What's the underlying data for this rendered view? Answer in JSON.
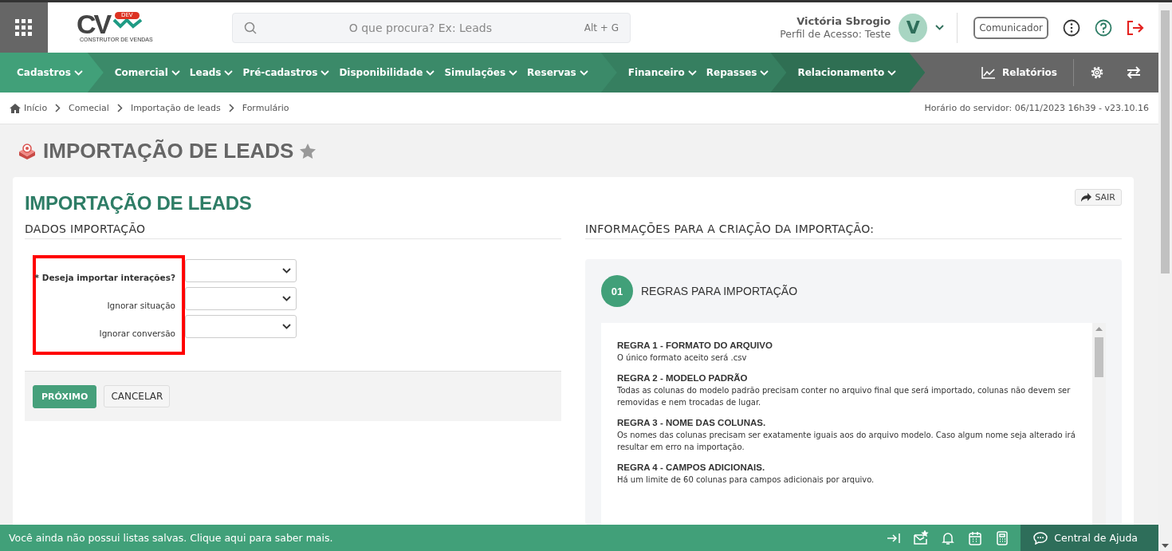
{
  "topbar": {
    "logo": {
      "letters": "CV",
      "badge": "DEV",
      "tagline": "CONSTRUTOR DE VENDAS"
    },
    "search": {
      "placeholder": "O que procura? Ex: Leads",
      "shortcut": "Alt + G"
    },
    "user": {
      "name": "Victória Sbrogio",
      "profile": "Perfil de Acesso: Teste",
      "initial": "V"
    },
    "communicator": "Comunicador"
  },
  "nav": {
    "groups": [
      {
        "color": "#41a079",
        "items": [
          "Cadastros"
        ]
      },
      {
        "color": "#3b8a69",
        "items": [
          "Comercial",
          "Leads",
          "Pré-cadastros",
          "Disponibilidade",
          "Simulações",
          "Reservas"
        ]
      },
      {
        "color": "#367f60",
        "items": [
          "Financeiro",
          "Repasses"
        ]
      },
      {
        "color": "#2f6f53",
        "items": [
          "Relacionamento"
        ]
      }
    ],
    "reports": "Relatórios"
  },
  "breadcrumb": {
    "items": [
      "Início",
      "Comecial",
      "Importação de leads",
      "Formulário"
    ],
    "server_time": "Horário do servidor: 06/11/2023 16h39 - v23.10.16"
  },
  "page_title": "IMPORTAÇÃO DE LEADS",
  "favorite": false,
  "card": {
    "title": "IMPORTAÇÃO DE LEADS",
    "exit": "SAIR",
    "form": {
      "heading": "DADOS IMPORTAÇÃO",
      "highlighted": true,
      "fields": [
        {
          "label": "* Deseja importar interações?",
          "required": true
        },
        {
          "label": "Ignorar situação",
          "required": false
        },
        {
          "label": "Ignorar conversão",
          "required": false
        }
      ],
      "buttons": [
        {
          "label": "PRÓXIMO",
          "kind": "primary"
        },
        {
          "label": "CANCELAR",
          "kind": "default"
        }
      ]
    },
    "info": {
      "heading": "INFORMAÇÕES PARA A CRIAÇÃO DA IMPORTAÇÃO:",
      "step": "01",
      "step_title": "REGRAS PARA IMPORTAÇÃO",
      "rules": [
        {
          "title": "REGRA 1 - FORMATO DO ARQUIVO",
          "text": "O único formato aceito será .csv"
        },
        {
          "title": "REGRA 2 - MODELO PADRÃO",
          "text": "Todas as colunas do modelo padrão precisam conter no arquivo final que será importado, colunas não devem ser removidas e nem trocadas de lugar."
        },
        {
          "title": "REGRA 3 - NOME DAS COLUNAS.",
          "text": "Os nomes das colunas precisam ser exatamente iguais aos do arquivo modelo. Caso algum nome seja alterado irá resultar em erro na importação."
        },
        {
          "title": "REGRA 4 - CAMPOS ADICIONAIS.",
          "text": "Há um limite de 60 colunas para campos adicionais por arquivo."
        }
      ]
    }
  },
  "status_bar": {
    "message": "Você ainda não possui listas salvas. Clique aqui para saber mais.",
    "help": "Central de Ajuda"
  }
}
